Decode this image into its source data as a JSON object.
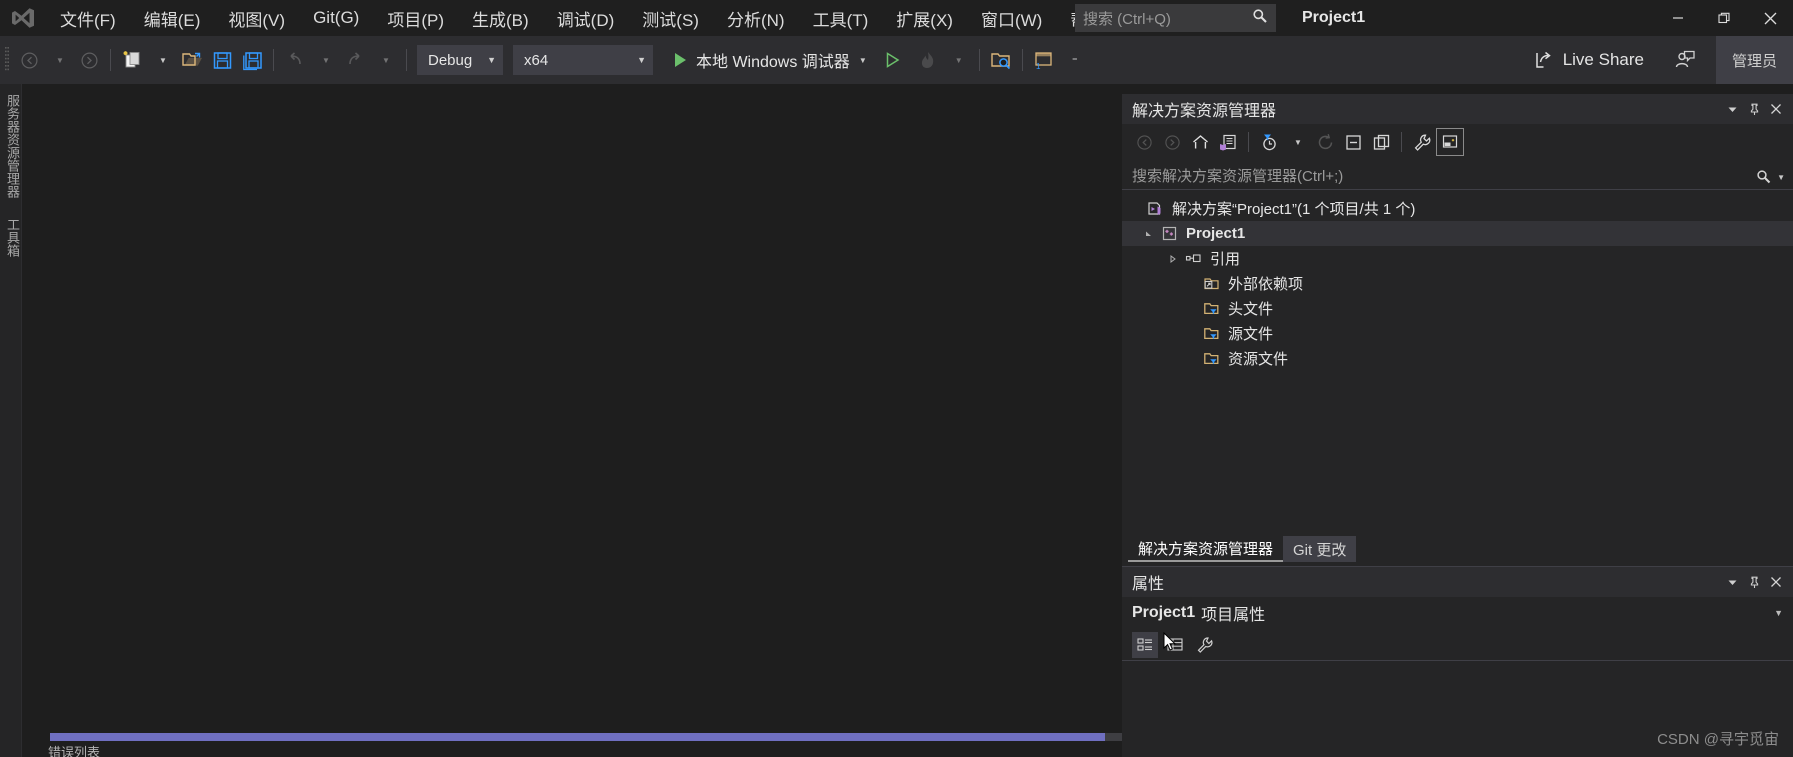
{
  "titlebar": {
    "logo_icon": "visual-studio-logo",
    "menus": [
      {
        "label": "文件(F)"
      },
      {
        "label": "编辑(E)"
      },
      {
        "label": "视图(V)"
      },
      {
        "label": "Git(G)"
      },
      {
        "label": "项目(P)"
      },
      {
        "label": "生成(B)"
      },
      {
        "label": "调试(D)"
      },
      {
        "label": "测试(S)"
      },
      {
        "label": "分析(N)"
      },
      {
        "label": "工具(T)"
      },
      {
        "label": "扩展(X)"
      },
      {
        "label": "窗口(W)"
      },
      {
        "label": "帮助(H)"
      }
    ],
    "search_placeholder": "搜索 (Ctrl+Q)",
    "search_icon": "search-icon",
    "window_title": "Project1",
    "minimize": "—",
    "maximize": "❐",
    "close": "✕"
  },
  "toolbar": {
    "nav_back_icon": "navigate-back-icon",
    "nav_forward_icon": "navigate-forward-icon",
    "new_item_icon": "new-item-icon",
    "open_file_icon": "open-file-icon",
    "save_icon": "save-icon",
    "save_all_icon": "save-all-icon",
    "undo_icon": "undo-icon",
    "redo_icon": "redo-icon",
    "configuration": "Debug",
    "platform": "x64",
    "run_label": "本地 Windows 调试器",
    "run_icon": "play-filled-icon",
    "start_without_debug_icon": "play-outline-icon",
    "hot_reload_icon": "hot-reload-icon",
    "search_solution_icon": "folder-search-icon",
    "window_layout_icon": "window-layout-icon",
    "live_share_label": "Live Share",
    "live_share_icon": "share-icon",
    "feedback_icon": "feedback-person-icon",
    "admin_label": "管理员"
  },
  "left_strip": {
    "tabs": [
      {
        "label": "服务器资源管理器"
      },
      {
        "label": "工具箱"
      }
    ]
  },
  "editor": {
    "bottom_label": "错误列表"
  },
  "solution_explorer": {
    "title": "解决方案资源管理器",
    "header_buttons": {
      "dropdown": "▾",
      "pin": "pin-icon",
      "close": "✕"
    },
    "toolbar_icons": [
      {
        "name": "back-icon",
        "glyph": "←"
      },
      {
        "name": "forward-icon",
        "glyph": "→"
      },
      {
        "name": "home-icon",
        "glyph": "⌂"
      },
      {
        "name": "solution-overview-icon",
        "glyph": "▤"
      },
      {
        "name": "pending-changes-filter-icon",
        "glyph": "◔"
      },
      {
        "name": "refresh-icon",
        "glyph": "⟳"
      },
      {
        "name": "collapse-all-icon",
        "glyph": "⊟"
      },
      {
        "name": "show-all-files-icon",
        "glyph": "❐"
      },
      {
        "name": "properties-wrench-icon",
        "glyph": "🔧"
      },
      {
        "name": "preview-selected-items-icon",
        "glyph": "▭"
      }
    ],
    "search_placeholder": "搜索解决方案资源管理器(Ctrl+;)",
    "search_icon": "search-icon",
    "tree": [
      {
        "label": "解决方案“Project1”(1 个项目/共 1 个)",
        "icon": "solution-icon",
        "indent": 0,
        "arrow": "",
        "bold": false
      },
      {
        "label": "Project1",
        "icon": "cpp-project-icon",
        "indent": 1,
        "arrow": "▴",
        "bold": true,
        "selected": true
      },
      {
        "label": "引用",
        "icon": "references-icon",
        "indent": 2,
        "arrow": "▸",
        "bold": false
      },
      {
        "label": "外部依赖项",
        "icon": "external-dependencies-icon",
        "indent": 2,
        "arrow": "",
        "bold": false
      },
      {
        "label": "头文件",
        "icon": "header-files-folder-icon",
        "indent": 2,
        "arrow": "",
        "bold": false
      },
      {
        "label": "源文件",
        "icon": "source-files-folder-icon",
        "indent": 2,
        "arrow": "",
        "bold": false
      },
      {
        "label": "资源文件",
        "icon": "resource-files-folder-icon",
        "indent": 2,
        "arrow": "",
        "bold": false
      }
    ],
    "tabs": [
      {
        "label": "解决方案资源管理器",
        "active": true
      },
      {
        "label": "Git 更改",
        "active": false
      }
    ]
  },
  "properties": {
    "title": "属性",
    "header_buttons": {
      "dropdown": "▾",
      "pin": "pin-icon",
      "close": "✕"
    },
    "object_name": "Project1",
    "object_kind": "项目属性",
    "object_dropdown": "▾",
    "toolbar_icons": [
      {
        "name": "categorized-view-icon",
        "glyph": "▦"
      },
      {
        "name": "alphabetical-view-icon",
        "glyph": "▩"
      },
      {
        "name": "property-pages-icon",
        "glyph": "🔧"
      }
    ]
  },
  "watermark": "CSDN @寻宇觅宙",
  "colors": {
    "accent_blue": "#3399ff",
    "titlebar_bg": "#1f1f1f",
    "toolbar_bg": "#2d2d30",
    "panel_bg": "#252526",
    "editor_bg": "#1e1e1e",
    "text": "#e6e6e6",
    "green_run": "#6bbf6b",
    "folder_yellow": "#dcb67a",
    "purple": "#b180d7"
  }
}
